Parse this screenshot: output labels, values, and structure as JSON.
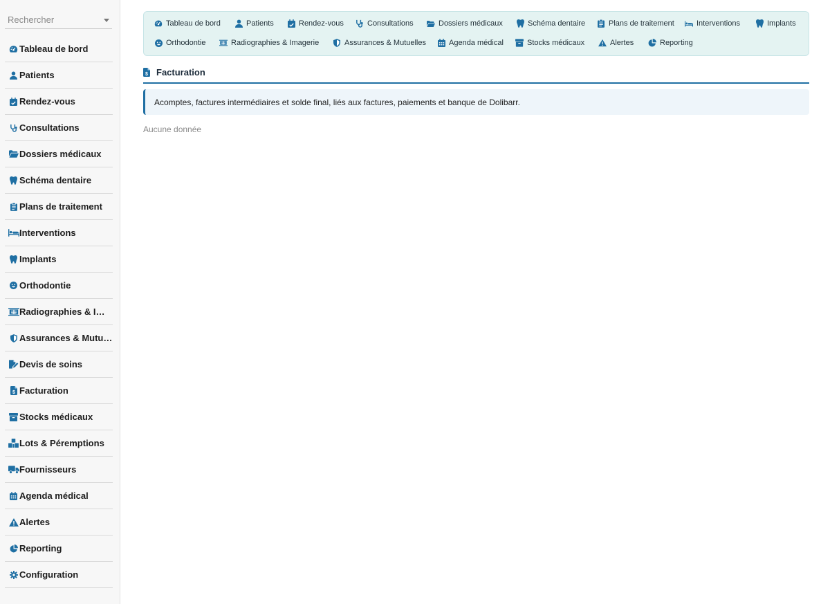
{
  "search": {
    "placeholder": "Rechercher"
  },
  "sidebar": {
    "items": [
      {
        "label": "Tableau de bord",
        "icon": "dashboard-icon"
      },
      {
        "label": "Patients",
        "icon": "user-icon"
      },
      {
        "label": "Rendez-vous",
        "icon": "calendar-check-icon"
      },
      {
        "label": "Consultations",
        "icon": "stethoscope-icon"
      },
      {
        "label": "Dossiers médicaux",
        "icon": "folder-open-icon"
      },
      {
        "label": "Schéma dentaire",
        "icon": "tooth-icon"
      },
      {
        "label": "Plans de traitement",
        "icon": "clipboard-icon"
      },
      {
        "label": "Interventions",
        "icon": "procedure-bed-icon"
      },
      {
        "label": "Implants",
        "icon": "tooth-icon"
      },
      {
        "label": "Orthodontie",
        "icon": "smile-icon"
      },
      {
        "label": "Radiographies & Imagerie",
        "icon": "xray-icon"
      },
      {
        "label": "Assurances & Mutuelles",
        "icon": "shield-icon"
      },
      {
        "label": "Devis de soins",
        "icon": "edit-document-icon"
      },
      {
        "label": "Facturation",
        "icon": "invoice-dollar-icon"
      },
      {
        "label": "Stocks médicaux",
        "icon": "box-icon"
      },
      {
        "label": "Lots & Péremptions",
        "icon": "cubes-icon"
      },
      {
        "label": "Fournisseurs",
        "icon": "truck-icon"
      },
      {
        "label": "Agenda médical",
        "icon": "calendar-icon"
      },
      {
        "label": "Alertes",
        "icon": "warning-icon"
      },
      {
        "label": "Reporting",
        "icon": "pie-chart-icon"
      },
      {
        "label": "Configuration",
        "icon": "gear-icon"
      }
    ]
  },
  "top_nav": {
    "row1": [
      {
        "label": "Tableau de bord",
        "icon": "dashboard-icon"
      },
      {
        "label": "Patients",
        "icon": "user-icon"
      },
      {
        "label": "Rendez-vous",
        "icon": "calendar-check-icon"
      },
      {
        "label": "Consultations",
        "icon": "stethoscope-icon"
      },
      {
        "label": "Dossiers médicaux",
        "icon": "folder-open-icon"
      },
      {
        "label": "Schéma dentaire",
        "icon": "tooth-icon"
      },
      {
        "label": "Plans de traitement",
        "icon": "clipboard-icon"
      },
      {
        "label": "Interventions",
        "icon": "procedure-bed-icon"
      },
      {
        "label": "Implants",
        "icon": "tooth-icon"
      }
    ],
    "row2": [
      {
        "label": "Orthodontie",
        "icon": "smile-icon"
      },
      {
        "label": "Radiographies & Imagerie",
        "icon": "xray-icon"
      },
      {
        "label": "Assurances & Mutuelles",
        "icon": "shield-icon"
      },
      {
        "label": "Agenda médical",
        "icon": "calendar-icon"
      },
      {
        "label": "Stocks médicaux",
        "icon": "box-icon"
      },
      {
        "label": "Alertes",
        "icon": "warning-icon"
      },
      {
        "label": "Reporting",
        "icon": "pie-chart-icon"
      }
    ]
  },
  "page": {
    "title": "Facturation",
    "title_icon": "invoice-dollar-icon",
    "info": "Acomptes, factures intermédiaires et solde final, liés aux factures, paiements et banque de Dolibarr.",
    "empty": "Aucune donnée"
  },
  "colors": {
    "accent": "#1f6fa3",
    "icon": "#1f6fa3",
    "nav_bg": "#e4f3f2",
    "info_bg": "#eef5fa"
  }
}
